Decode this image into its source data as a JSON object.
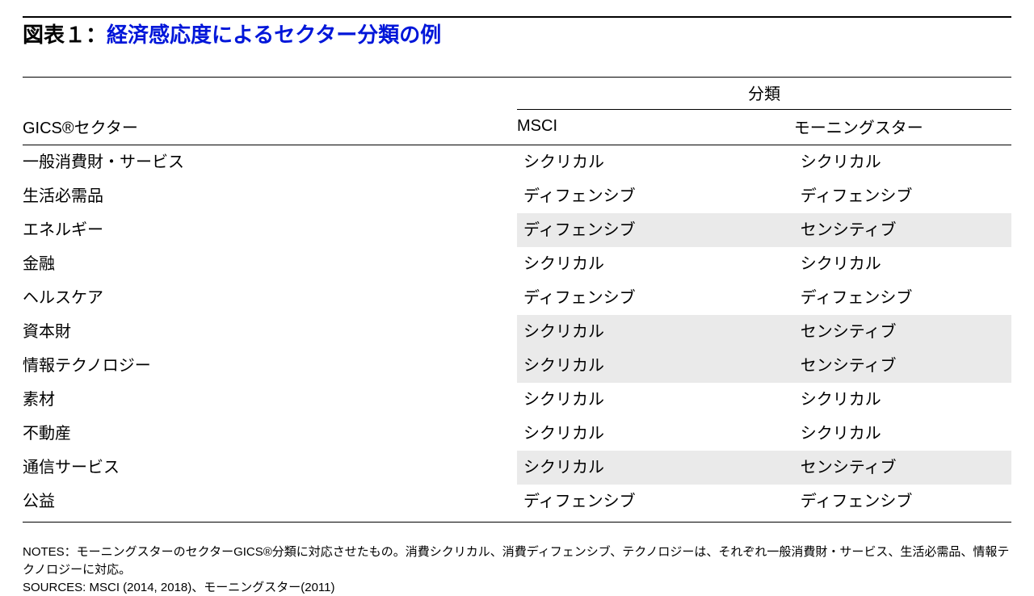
{
  "title": {
    "lead": "図表１：",
    "highlight": "経済感応度によるセクター分類の例"
  },
  "headers": {
    "sector": "GICS®セクター",
    "category": "分類",
    "msci": "MSCI",
    "morningstar": "モーニングスター"
  },
  "rows": [
    {
      "sector": "一般消費財・サービス",
      "msci": "シクリカル",
      "morningstar": "シクリカル",
      "shade": false
    },
    {
      "sector": "生活必需品",
      "msci": "ディフェンシブ",
      "morningstar": "ディフェンシブ",
      "shade": false
    },
    {
      "sector": "エネルギー",
      "msci": "ディフェンシブ",
      "morningstar": "センシティブ",
      "shade": true
    },
    {
      "sector": "金融",
      "msci": "シクリカル",
      "morningstar": "シクリカル",
      "shade": false
    },
    {
      "sector": "ヘルスケア",
      "msci": "ディフェンシブ",
      "morningstar": "ディフェンシブ",
      "shade": false
    },
    {
      "sector": "資本財",
      "msci": "シクリカル",
      "morningstar": "センシティブ",
      "shade": true
    },
    {
      "sector": "情報テクノロジー",
      "msci": "シクリカル",
      "morningstar": "センシティブ",
      "shade": true
    },
    {
      "sector": "素材",
      "msci": "シクリカル",
      "morningstar": "シクリカル",
      "shade": false
    },
    {
      "sector": "不動産",
      "msci": "シクリカル",
      "morningstar": "シクリカル",
      "shade": false
    },
    {
      "sector": "通信サービス",
      "msci": "シクリカル",
      "morningstar": "センシティブ",
      "shade": true
    },
    {
      "sector": "公益",
      "msci": "ディフェンシブ",
      "morningstar": "ディフェンシブ",
      "shade": false
    }
  ],
  "footer": {
    "notes": "NOTES：モーニングスターのセクターGICS®分類に対応させたもの。消費シクリカル、消費ディフェンシブ、テクノロジーは、それぞれ一般消費財・サービス、生活必需品、情報テクノロジーに対応。",
    "sources": "SOURCES: MSCI (2014, 2018)、モーニングスター(2011)"
  },
  "chart_data": {
    "type": "table",
    "title": "経済感応度によるセクター分類の例",
    "columns": [
      "GICS®セクター",
      "MSCI",
      "モーニングスター"
    ],
    "rows": [
      [
        "一般消費財・サービス",
        "シクリカル",
        "シクリカル"
      ],
      [
        "生活必需品",
        "ディフェンシブ",
        "ディフェンシブ"
      ],
      [
        "エネルギー",
        "ディフェンシブ",
        "センシティブ"
      ],
      [
        "金融",
        "シクリカル",
        "シクリカル"
      ],
      [
        "ヘルスケア",
        "ディフェンシブ",
        "ディフェンシブ"
      ],
      [
        "資本財",
        "シクリカル",
        "センシティブ"
      ],
      [
        "情報テクノロジー",
        "シクリカル",
        "センシティブ"
      ],
      [
        "素材",
        "シクリカル",
        "シクリカル"
      ],
      [
        "不動産",
        "シクリカル",
        "シクリカル"
      ],
      [
        "通信サービス",
        "シクリカル",
        "センシティブ"
      ],
      [
        "公益",
        "ディフェンシブ",
        "ディフェンシブ"
      ]
    ]
  }
}
